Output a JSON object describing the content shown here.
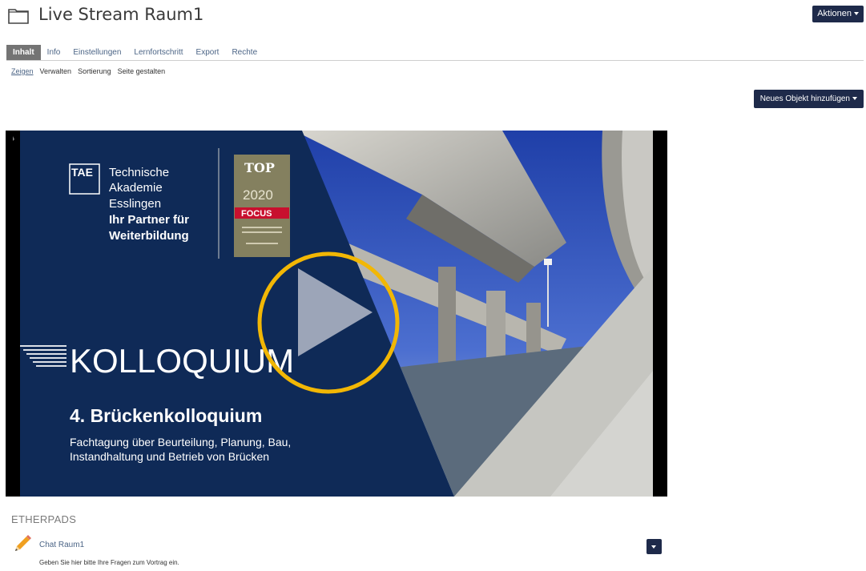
{
  "header": {
    "title": "Live Stream Raum1",
    "actions_label": "Aktionen"
  },
  "tabs": [
    {
      "label": "Inhalt",
      "active": true
    },
    {
      "label": "Info"
    },
    {
      "label": "Einstellungen"
    },
    {
      "label": "Lernfortschritt"
    },
    {
      "label": "Export"
    },
    {
      "label": "Rechte"
    }
  ],
  "subtabs": [
    {
      "label": "Zeigen",
      "active": true
    },
    {
      "label": "Verwalten"
    },
    {
      "label": "Sortierung"
    },
    {
      "label": "Seite gestalten"
    }
  ],
  "toolbar": {
    "add_object_label": "Neues Objekt hinzufügen"
  },
  "video": {
    "logo_abbr": "TAE",
    "org_line1": "Technische",
    "org_line2": "Akademie",
    "org_line3": "Esslingen",
    "tagline1": "Ihr Partner für",
    "tagline2": "Weiterbildung",
    "badge_top": "TOP",
    "badge_year": "2020",
    "badge_brand": "FOCUS",
    "event_label": "KOLLOQUIUM",
    "event_title": "4. Brückenkolloquium",
    "event_sub1": "Fachtagung über Beurteilung, Planung, Bau,",
    "event_sub2": "Instandhaltung und Betrieb von Brücken",
    "play_icon": "play-icon",
    "highlight_color": "#f2b705"
  },
  "etherpads": {
    "section_title": "ETHERPADS",
    "items": [
      {
        "title": "Chat Raum1",
        "description": "Geben Sie hier bitte Ihre Fragen zum Vortrag ein.",
        "icon": "pencil-icon"
      }
    ]
  },
  "colors": {
    "brand_dark": "#1e2a4a",
    "active_tab": "#747474",
    "link": "#4c6586",
    "video_blue": "#0f2a57"
  }
}
